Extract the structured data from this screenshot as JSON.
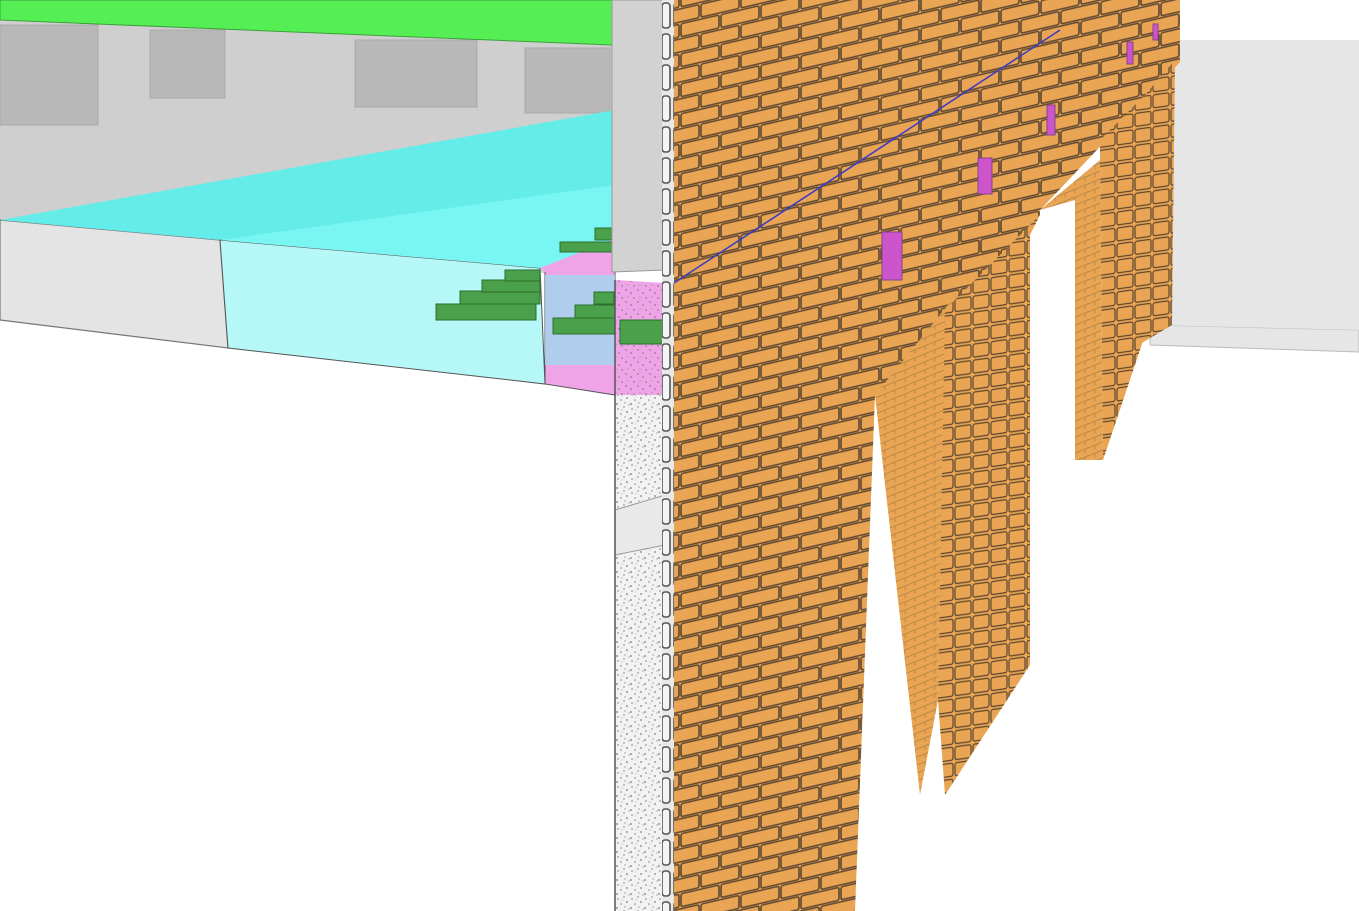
{
  "viewport": {
    "kind": "3d-bim-model-view",
    "background_color": "#ffffff"
  },
  "colors": {
    "brick": "#e9a553",
    "brick_mortar": "#5c4630",
    "brick_mortar_light": "#b88845",
    "slab_green": "#55ef55",
    "insulation_cyan": "#64ece8",
    "insulation_cyan_light": "#b6f7f8",
    "membrane_pink": "#f0a4e8",
    "membrane_magenta": "#cc55cc",
    "rebar_green": "#4ba04b",
    "interior_grey": "#cfcfcf",
    "interior_grey_dark": "#b8b8b8",
    "slab_face_grey": "#e4e4e4",
    "concrete_speckle": "#9a9a9a",
    "column_grey": "#d2d2d2",
    "far_wall_grey": "#e6e6e6"
  },
  "model_elements": [
    {
      "element": "upper-slab",
      "material": "slab_green"
    },
    {
      "element": "interior-room",
      "material": "interior_grey"
    },
    {
      "element": "floor-slab-face",
      "material": "slab_face_grey"
    },
    {
      "element": "insulation-layer",
      "material": "insulation_cyan"
    },
    {
      "element": "rebar",
      "material": "rebar_green"
    },
    {
      "element": "membrane",
      "material": "membrane_pink"
    },
    {
      "element": "concrete-column",
      "material": "concrete_speckle"
    },
    {
      "element": "brick-facade",
      "material": "brick"
    },
    {
      "element": "brick-piers",
      "material": "brick"
    },
    {
      "element": "far-wall",
      "material": "far_wall_grey"
    }
  ]
}
